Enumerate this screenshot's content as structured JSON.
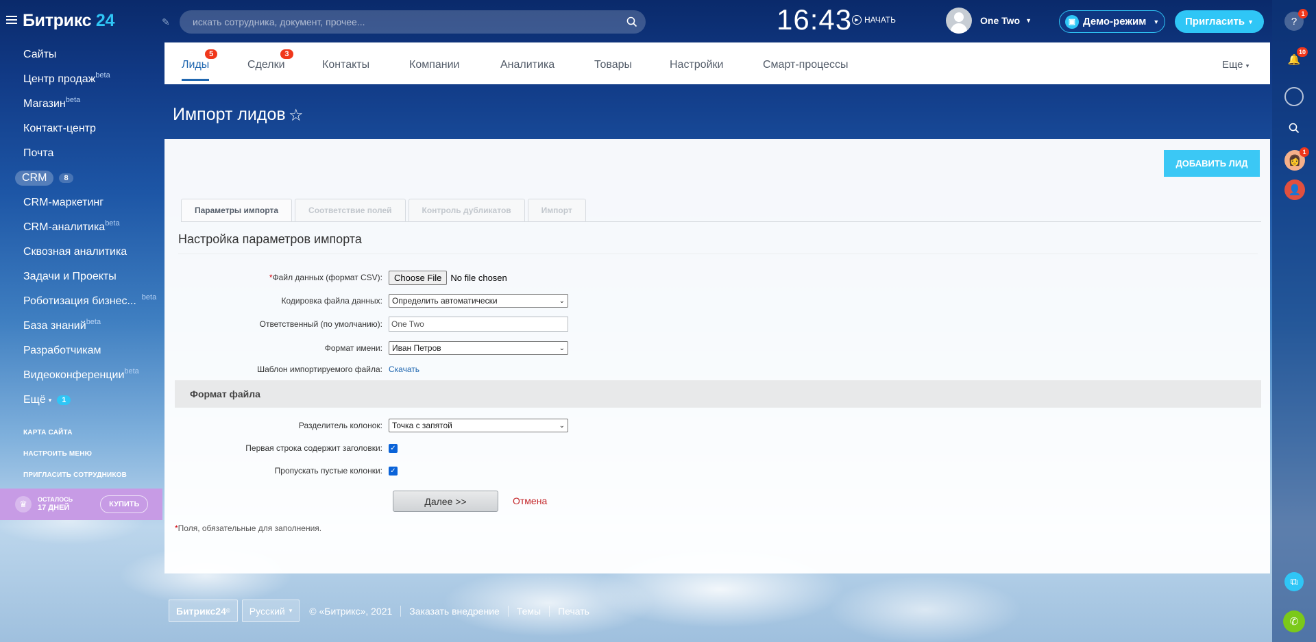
{
  "header": {
    "logo_text": "Битрикс",
    "logo_num": "24",
    "search_placeholder": "искать сотрудника, документ, прочее...",
    "clock": "16:43",
    "start_label": "НАЧАТЬ",
    "user_name": "One Two",
    "demo_label": "Демо-режим",
    "invite_label": "Пригласить"
  },
  "left_menu": {
    "items": [
      {
        "label": "Сайты",
        "sup": ""
      },
      {
        "label": "Центр продаж",
        "sup": "beta"
      },
      {
        "label": "Магазин",
        "sup": "beta"
      },
      {
        "label": "Контакт-центр",
        "sup": ""
      },
      {
        "label": "Почта",
        "sup": ""
      },
      {
        "label": "CRM",
        "sup": "",
        "count": "8"
      },
      {
        "label": "CRM-маркетинг",
        "sup": ""
      },
      {
        "label": "CRM-аналитика",
        "sup": "beta"
      },
      {
        "label": "Сквозная аналитика",
        "sup": ""
      },
      {
        "label": "Задачи и Проекты",
        "sup": ""
      },
      {
        "label": "Роботизация бизнес...",
        "sup": "beta"
      },
      {
        "label": "База знаний",
        "sup": "beta"
      },
      {
        "label": "Разработчикам",
        "sup": ""
      },
      {
        "label": "Видеоконференции",
        "sup": "beta"
      },
      {
        "label": "Ещё",
        "sup": "",
        "count": "1"
      }
    ],
    "links": [
      "КАРТА САЙТА",
      "НАСТРОИТЬ МЕНЮ",
      "ПРИГЛАСИТЬ СОТРУДНИКОВ"
    ],
    "promo": {
      "left_label": "ОСТАЛОСЬ",
      "days": "17 ДНЕЙ",
      "buy": "КУПИТЬ"
    }
  },
  "tabs": [
    {
      "label": "Лиды",
      "badge": "5",
      "active": true
    },
    {
      "label": "Сделки",
      "badge": "3",
      "active": false
    },
    {
      "label": "Контакты",
      "badge": "",
      "active": false
    },
    {
      "label": "Компании",
      "badge": "",
      "active": false
    },
    {
      "label": "Аналитика",
      "badge": "",
      "active": false
    },
    {
      "label": "Товары",
      "badge": "",
      "active": false
    },
    {
      "label": "Настройки",
      "badge": "",
      "active": false
    },
    {
      "label": "Смарт-процессы",
      "badge": "",
      "active": false
    }
  ],
  "more_label": "Еще",
  "page_title": "Импорт лидов",
  "add_lead": "ДОБАВИТЬ ЛИД",
  "import_tabs": [
    "Параметры импорта",
    "Соответствие полей",
    "Контроль дубликатов",
    "Импорт"
  ],
  "section_title": "Настройка параметров импорта",
  "form": {
    "file_label": "Файл данных (формат CSV):",
    "file_button": "Choose File",
    "file_status": "No file chosen",
    "encoding_label": "Кодировка файла данных:",
    "encoding_value": "Определить автоматически",
    "responsible_label": "Ответственный (по умолчанию):",
    "responsible_value": "One Two",
    "name_format_label": "Формат имени:",
    "name_format_value": "Иван Петров",
    "template_label": "Шаблон импортируемого файла:",
    "template_link": "Скачать",
    "group_title": "Формат файла",
    "separator_label": "Разделитель колонок:",
    "separator_value": "Точка с запятой",
    "header_row_label": "Первая строка содержит заголовки:",
    "skip_empty_label": "Пропускать пустые колонки:",
    "next_button": "Далее >>",
    "cancel_link": "Отмена",
    "required_note": "Поля, обязательные для заполнения."
  },
  "footer": {
    "brand": "Битрикс24",
    "lang": "Русский",
    "copyright": "© «Битрикс», 2021",
    "order": "Заказать внедрение",
    "themes": "Темы",
    "print": "Печать"
  },
  "rail": {
    "help_badge": "1",
    "notif_badge": "10",
    "avatar_badge": "1"
  },
  "colors": {
    "accent": "#2fc6f6",
    "tab_active": "#2067b0",
    "badge": "#f0371b",
    "promo": "#c79be5"
  }
}
